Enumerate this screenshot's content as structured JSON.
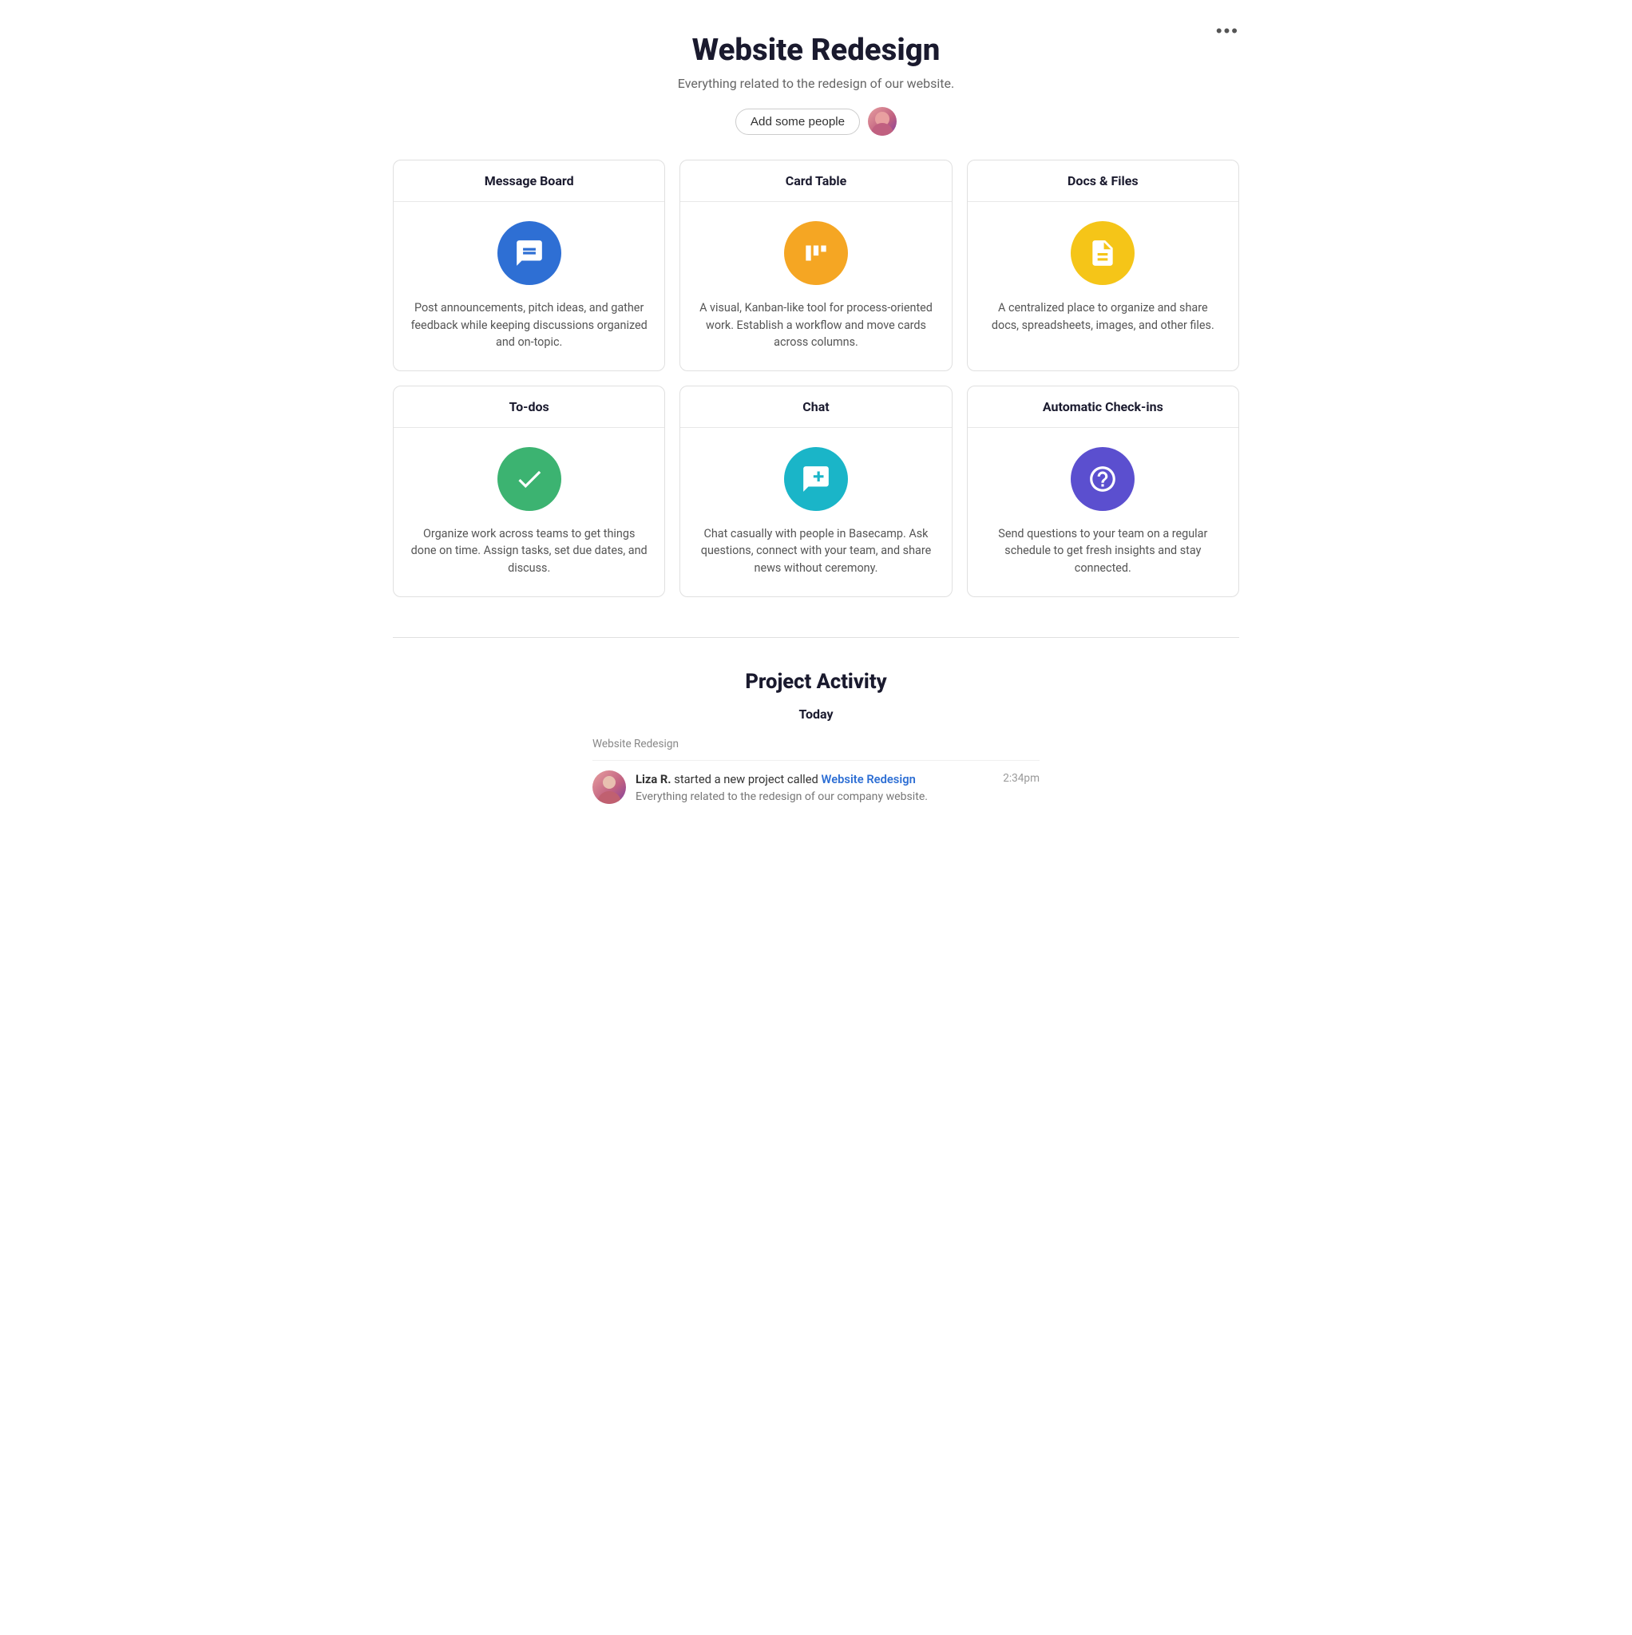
{
  "page": {
    "title": "Website Redesign",
    "subtitle": "Everything related to the redesign of our website.",
    "more_button_label": "•••"
  },
  "header": {
    "add_people_label": "Add some people",
    "avatar_alt": "User avatar"
  },
  "tools": [
    {
      "id": "message-board",
      "title": "Message Board",
      "icon_color": "icon-blue",
      "icon_name": "message-board-icon",
      "description": "Post announcements, pitch ideas, and gather feedback while keeping discussions organized and on-topic."
    },
    {
      "id": "card-table",
      "title": "Card Table",
      "icon_color": "icon-orange",
      "icon_name": "card-table-icon",
      "description": "A visual, Kanban-like tool for process-oriented work. Establish a workflow and move cards across columns."
    },
    {
      "id": "docs-files",
      "title": "Docs & Files",
      "icon_color": "icon-yellow",
      "icon_name": "docs-files-icon",
      "description": "A centralized place to organize and share docs, spreadsheets, images, and other files."
    },
    {
      "id": "to-dos",
      "title": "To-dos",
      "icon_color": "icon-green",
      "icon_name": "todos-icon",
      "description": "Organize work across teams to get things done on time. Assign tasks, set due dates, and discuss."
    },
    {
      "id": "chat",
      "title": "Chat",
      "icon_color": "icon-teal",
      "icon_name": "chat-icon",
      "description": "Chat casually with people in Basecamp. Ask questions, connect with your team, and share news without ceremony."
    },
    {
      "id": "automatic-checkins",
      "title": "Automatic Check-ins",
      "icon_color": "icon-purple",
      "icon_name": "checkins-icon",
      "description": "Send questions to your team on a regular schedule to get fresh insights and stay connected."
    }
  ],
  "activity": {
    "section_title": "Project Activity",
    "today_label": "Today",
    "group_label": "Website Redesign",
    "items": [
      {
        "id": "activity-1",
        "user": "Liza R.",
        "action_text": "started a new project called",
        "link_text": "Website Redesign",
        "link_href": "#",
        "sub_text": "Everything related to the redesign of our company website.",
        "time": "2:34pm"
      }
    ]
  }
}
